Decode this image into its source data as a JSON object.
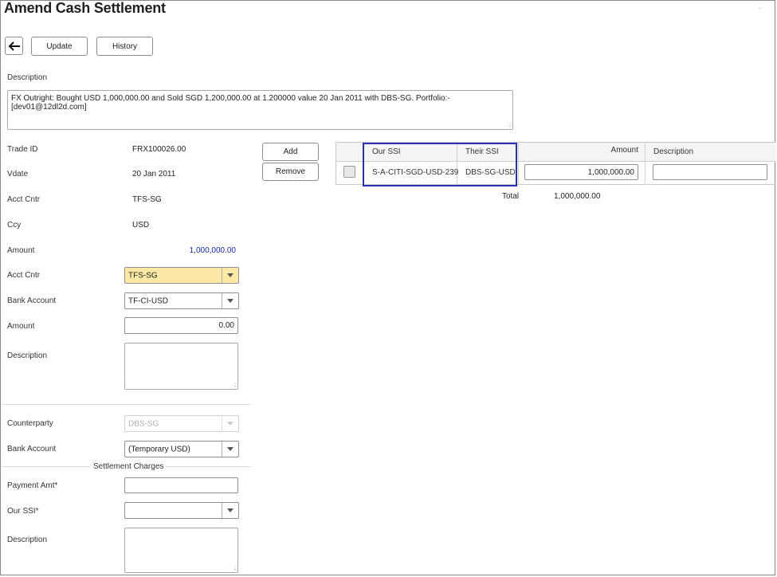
{
  "page": {
    "title": "Amend Cash Settlement"
  },
  "toolbar": {
    "back_icon": "arrow-left-icon",
    "update_label": "Update",
    "history_label": "History"
  },
  "description": {
    "label": "Description",
    "value": "FX Outright: Bought USD 1,000,000.00 and Sold SGD 1,200,000.00 at 1.200000 value 20 Jan 2011 with DBS-SG. Portfolio:- [dev01@12dl2d.com]"
  },
  "trade": {
    "trade_id_label": "Trade ID",
    "trade_id": "FRX100026.00",
    "vdate_label": "Vdate",
    "vdate": "20 Jan 2011",
    "acct_cntr_label": "Acct Cntr",
    "acct_cntr": "TFS-SG",
    "ccy_label": "Ccy",
    "ccy": "USD",
    "amount_label": "Amount",
    "amount": "1,000,000.00"
  },
  "our_side": {
    "acct_cntr_label": "Acct Cntr",
    "acct_cntr_value": "TFS-SG",
    "bank_account_label": "Bank Account",
    "bank_account_value": "TF-CI-USD",
    "amount_label": "Amount",
    "amount_value": "0.00",
    "description_label": "Description"
  },
  "counterparty": {
    "counterparty_label": "Counterparty",
    "counterparty_value": "DBS-SG",
    "bank_account_label": "Bank Account",
    "bank_account_value": "(Temporary USD)"
  },
  "settlement_charges": {
    "section_label": "Settlement Charges",
    "payment_amt_label": "Payment Amt*",
    "our_ssi_label": "Our SSI*",
    "description_label": "Description"
  },
  "actions": {
    "add_label": "Add",
    "remove_label": "Remove"
  },
  "ssi_table": {
    "headers": {
      "our_ssi": "Our SSI",
      "their_ssi": "Their SSI",
      "amount": "Amount",
      "description": "Description"
    },
    "rows": [
      {
        "our_ssi": "S-A-CITI-SGD-USD-239",
        "their_ssi": "DBS-SG-USD",
        "amount": "1,000,000.00",
        "description": ""
      }
    ],
    "total_label": "Total",
    "total_value": "1,000,000.00"
  },
  "colors": {
    "highlight_border": "#2b2fb3",
    "amount_blue": "#1a2aa8",
    "selected_field": "#fde9a6"
  }
}
